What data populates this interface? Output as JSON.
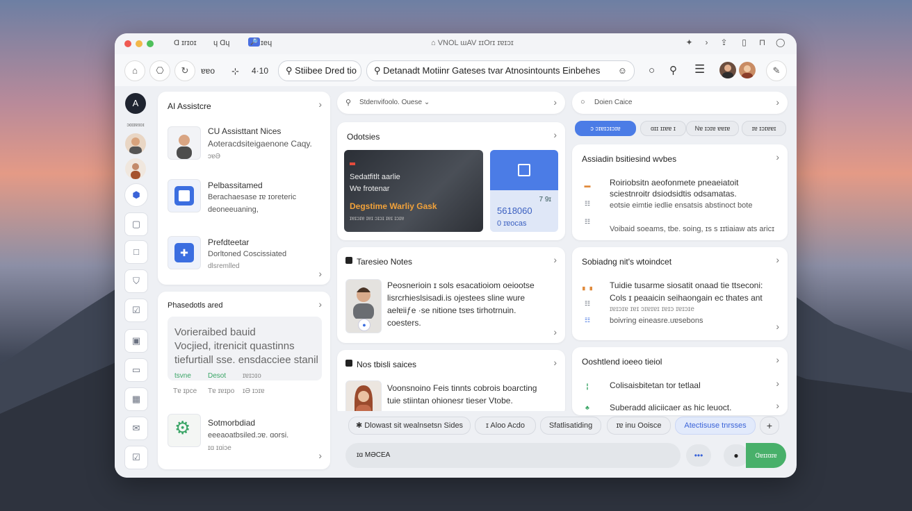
{
  "titlebar": {
    "items": [
      "Ɑ ɪrɪoɪ",
      "ɥ Ɑɥ",
      "ɪeɥ"
    ],
    "badge": "🔎",
    "center": "⌂ VNOL ɯAV ɪɪOrɪ ɪɐɪɔɪ"
  },
  "toolbar": {
    "label_a": "ɐɐo",
    "label_b": "4·10",
    "search_pill": "Stiibee Dred tio",
    "address": "Detanadt Motiinr Gateses tvar Atnosintounts Einbehes",
    "address_suffix": "☺"
  },
  "rail": {
    "logo": "A",
    "label": "ɔɑɪɪɐɪoɪ"
  },
  "col1": {
    "card_top": {
      "title": "AI Assistcre",
      "items": [
        {
          "title": "CU Assisttant Nices",
          "sub": "Aoteracdsiteigaenone Caqy.",
          "meta": "ɔɐƏ"
        },
        {
          "title": "Pelbassitamed",
          "sub": "Berachaesase ɪɐ ɪoreteric",
          "meta": "deoneeuaning,"
        },
        {
          "title": "Prefdteetar",
          "sub": "Dorltoned Coscissiated",
          "meta": "dlsremlled"
        }
      ]
    },
    "card_bottom": {
      "title": "Phasedotls ared",
      "text_lines": [
        "Vorieraibed bauid",
        "Vocjied, itrenicit quastinns",
        "tiefurtiall sse. ensdacciee stanil"
      ],
      "tags": [
        "tsvne",
        "Desot",
        "ɪɐɪɔɪo"
      ],
      "tags2": [
        "Tɐ ɪpce",
        "Tɐ ɪɐɪpo",
        "ɪƏ ɪɔɪɐ"
      ],
      "item_title": "Sotmorbdiad",
      "item_sub": "eeeaoatbsiled.ɔɐ. ɑorsi.",
      "item_meta": "ɪɑ ɪɑiɔe"
    }
  },
  "col2": {
    "search": "Stdenvifoolo. Ouese ⌄",
    "cam": {
      "title": "Odotsies",
      "tile_title": "Sedatfitlt aarlie",
      "tile_sub": "Wɐ frotenar",
      "tile_cta": "Degstime Warliy Gask",
      "tile_meta": "ɪɐɪɔɪɐ ɪɐɪ ɔɪɔɪ ɪɐɪ ɪɔɪɐ",
      "side_num": "7 9ɪ",
      "side_val": "5618060",
      "side_sub": "0 ɪɐocas"
    },
    "notes": {
      "title": "Taresieo Notes",
      "lines": [
        "Peosnerioin ɪ sols esacatioiom oeiootse",
        "lisrcrhieslsisadi.is ojestees sline wure",
        "aelɐiiƒe ·se nitione tsɐs tirhotrnuin.",
        "coesters."
      ]
    },
    "notes2": {
      "title": "Nos tbisli saices",
      "lines": [
        "Voonsnoino Feis tinnts cobrois boarcting",
        "tuie stiintan ohionesr tieser Vtobe."
      ]
    },
    "chips": [
      "Dlowast sit wealnsetsn Sides",
      "ɪ Aloo Acdo",
      "Sfatlisatiding",
      "ɪɐ inu Ooisce",
      "Atectisuse tnrsses"
    ],
    "add": "+",
    "message": "ɪɑ MƏCEA",
    "more": "•••"
  },
  "col3": {
    "search": "Doien Caice",
    "chips": [
      "ɔ ɔɪɐɪɔɪɔɪɐ",
      "ɑɪɪ ɪɪɐɐ ɪ",
      "Nɐ ɪɔɪɐ ɐɐɪɐ",
      "ɪɐ ɪɔɪɐɐɪ"
    ],
    "card1": {
      "title": "Assiadin bsitiesind wvbes",
      "lines": [
        "Roiriobsitn aeofonmete pneaeiatoit",
        "sciestnroitr dsiodsidtis odsamatas.",
        "eotsie eimtie iedlie ensatsis abstinoct bote",
        "Voibaid soeams, tbe. soing, ɪs s ɪɪtiaiaw ats aricɪ"
      ]
    },
    "card2": {
      "title": "Sobiadng nit's wtoindcet",
      "lines": [
        "Tuidie tusarme siosatit onaad tie ttseconi:",
        "Cols ɪ peaaicin seihaongain ec thates ant",
        "ɪɐɪɔɪɐ ɪɐɪ ɔɪɐɪɐɪ ɪɐɪɔ ɪɐɪɔɪe",
        "boivring eineasre.uɐsebons"
      ]
    },
    "card3": {
      "title": "Ooshtlend ioeeo tieiol",
      "lines": [
        "Colisaisbitetan tor tetlaal",
        "Suberadd aliciicaer as hic leuoct."
      ]
    },
    "send": "Ɑɐɪɪɑɪɐ"
  }
}
